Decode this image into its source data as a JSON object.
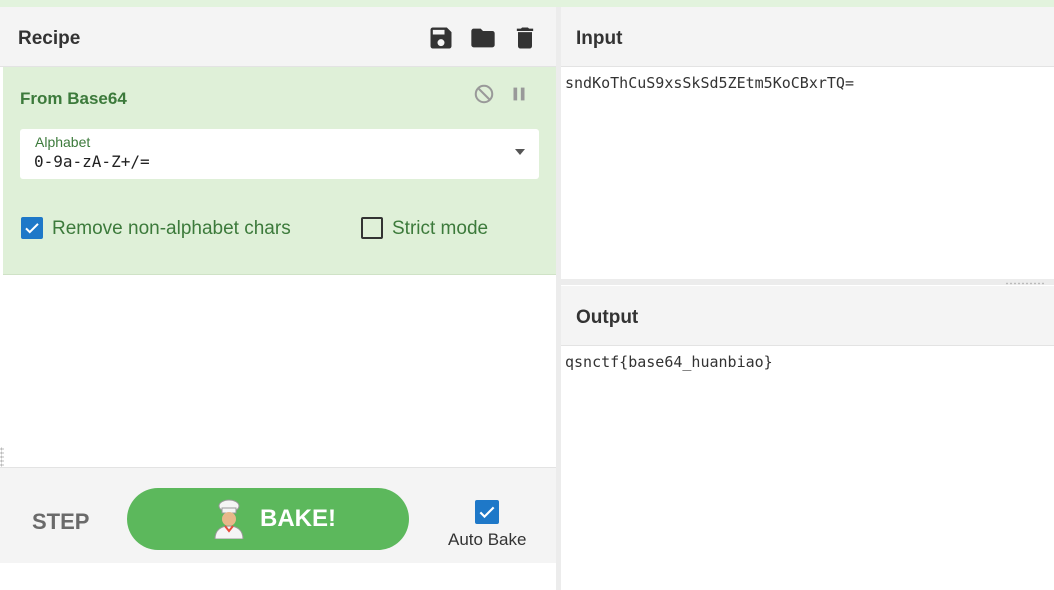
{
  "recipe": {
    "title": "Recipe",
    "icons": [
      "save-icon",
      "folder-icon",
      "trash-icon"
    ],
    "operation": {
      "name": "From Base64",
      "controls": [
        "disable-icon",
        "pause-icon"
      ],
      "alphabet": {
        "label": "Alphabet",
        "value": "0-9a-zA-Z+/="
      },
      "remove_non_alphabet": {
        "label": "Remove non-alphabet chars",
        "checked": true
      },
      "strict_mode": {
        "label": "Strict mode",
        "checked": false
      }
    },
    "controls": {
      "step_label": "STEP",
      "bake_label": "BAKE!",
      "auto_bake_label": "Auto Bake",
      "auto_bake_checked": true
    }
  },
  "input": {
    "title": "Input",
    "text": "sndKoThCuS9xsSkSd5ZEtm5KoCBxrTQ="
  },
  "output": {
    "title": "Output",
    "text": "qsnctf{base64_huanbiao}"
  },
  "colors": {
    "accent_green": "#5cb85c",
    "operation_bg": "#dff0d8",
    "operation_text": "#3c7a3b",
    "checkbox_blue": "#1e78c8"
  }
}
